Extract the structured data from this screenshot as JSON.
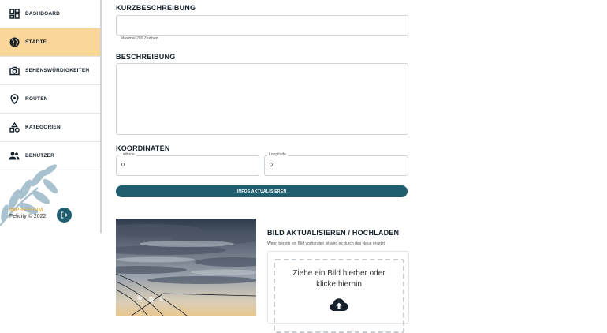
{
  "sidebar": {
    "items": [
      {
        "label": "DASHBOARD",
        "icon": "dashboard-icon",
        "active": false
      },
      {
        "label": "STÄDTE",
        "icon": "globe-icon",
        "active": true
      },
      {
        "label": "SEHENSWÜRDIGKEITEN",
        "icon": "camera-icon",
        "active": false
      },
      {
        "label": "ROUTEN",
        "icon": "map-pin-icon",
        "active": false
      },
      {
        "label": "KATEGORIEN",
        "icon": "shapes-icon",
        "active": false
      },
      {
        "label": "BENUTZER",
        "icon": "users-icon",
        "active": false
      }
    ],
    "impressum": "IMPRESSUM",
    "copyright": "Felicity © 2022",
    "logout_icon": "logout-icon"
  },
  "form": {
    "short_description": {
      "title": "KURZBESCHREIBUNG",
      "value": "",
      "hint": "Maximal 200 Zeichen"
    },
    "description": {
      "title": "BESCHREIBUNG",
      "value": ""
    },
    "coordinates": {
      "title": "KOORDINATEN",
      "latitude": {
        "label": "Latitude",
        "value": "0"
      },
      "longitude": {
        "label": "Longitude",
        "value": "0"
      }
    },
    "update_button": "INFOS AKTUALISIEREN"
  },
  "image_upload": {
    "title": "BILD AKTUALISIEREN / HOCHLADEN",
    "hint": "Wenn bereits ein Bild vorhanden ist wird es durch das Neue ersetzt!",
    "dropzone_text": "Ziehe ein Bild hierher oder klicke hierhin",
    "icon": "cloud-upload-icon"
  },
  "colors": {
    "accent": "#1e5e6e",
    "active_nav": "#fbd69b",
    "impressum": "#e5a21c"
  }
}
